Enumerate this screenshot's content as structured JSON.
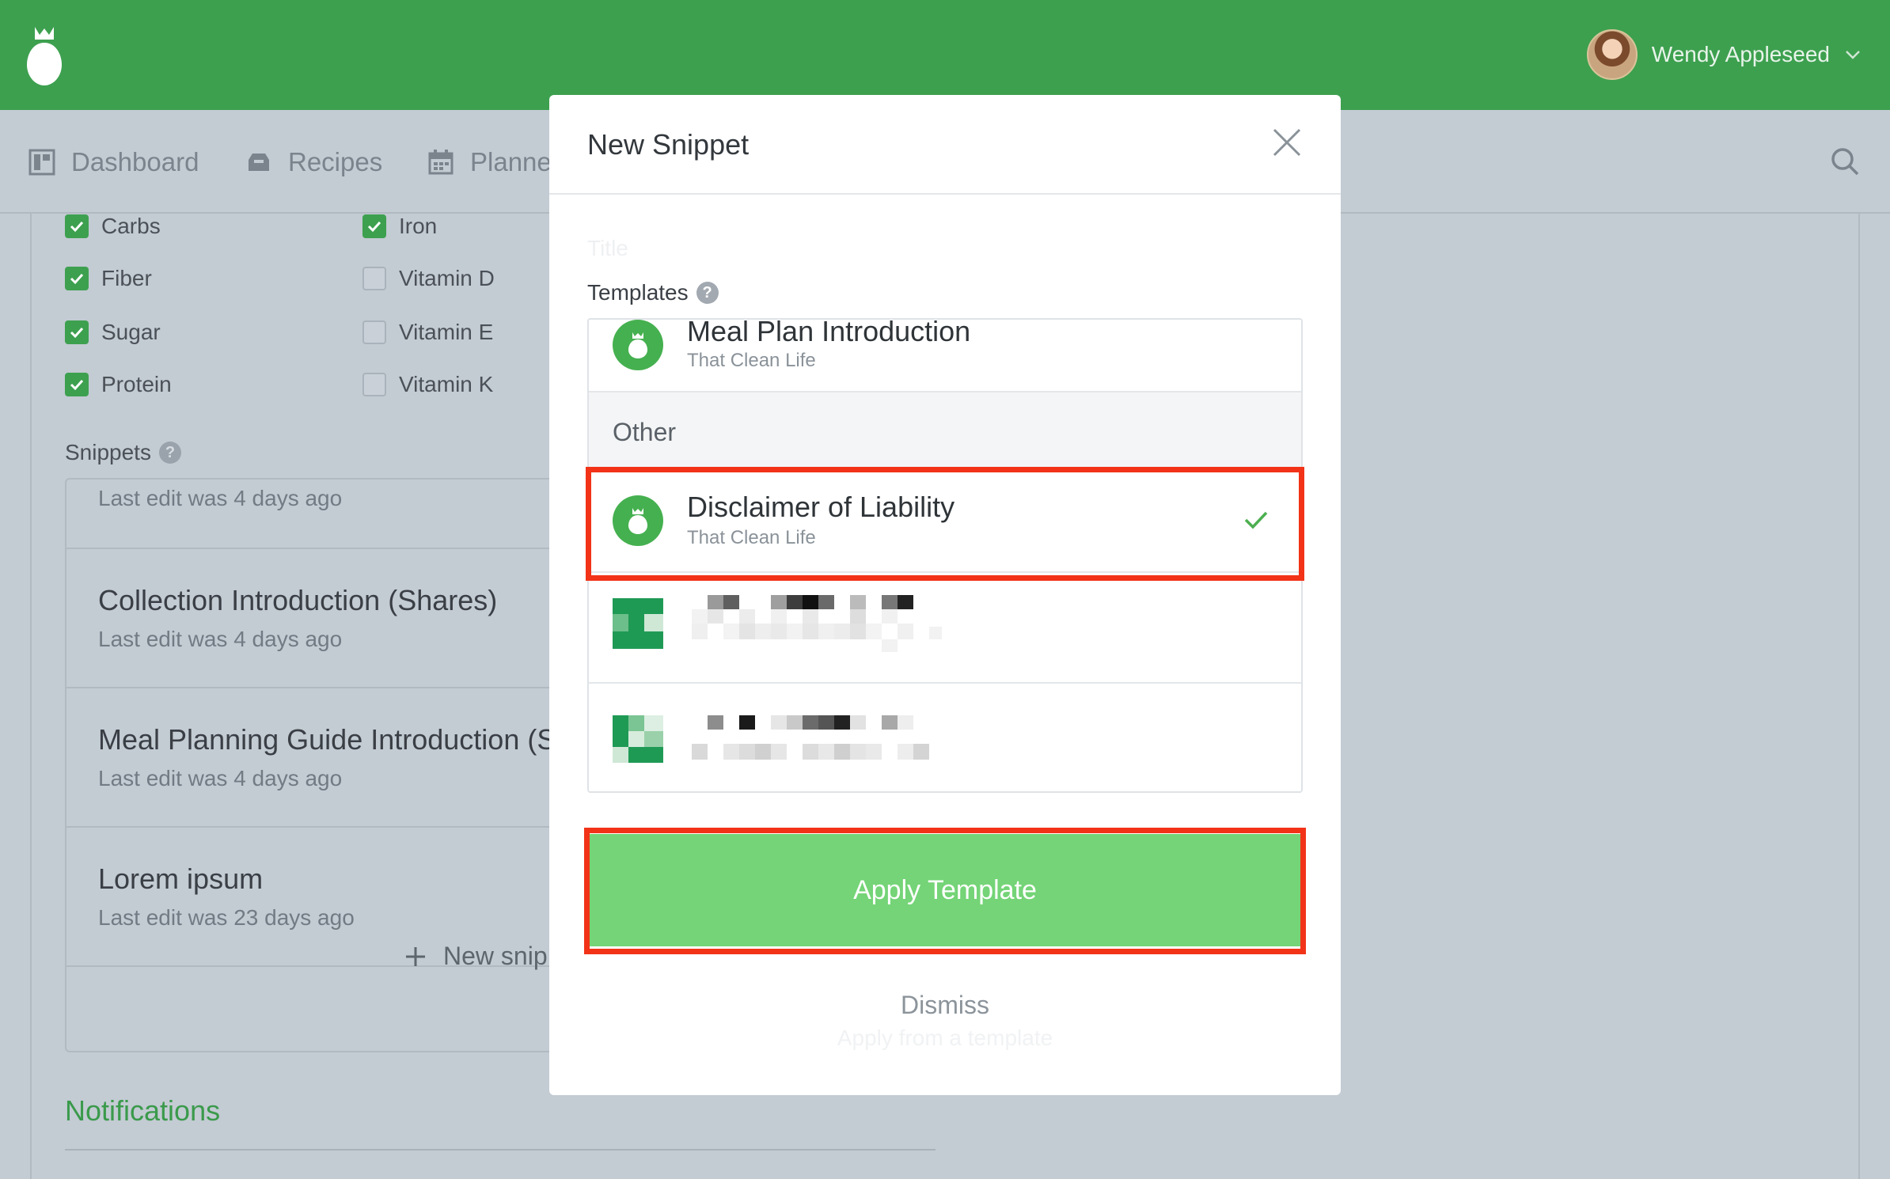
{
  "topbar": {
    "user_name": "Wendy Appleseed"
  },
  "nav": {
    "items": [
      {
        "label": "Dashboard",
        "icon": "dashboard-icon"
      },
      {
        "label": "Recipes",
        "icon": "inbox-icon"
      },
      {
        "label": "Planne",
        "icon": "calendar-icon"
      }
    ],
    "search_icon": "search-icon"
  },
  "nutrients": {
    "left": [
      {
        "label": "Carbs",
        "checked": true
      },
      {
        "label": "Fiber",
        "checked": true
      },
      {
        "label": "Sugar",
        "checked": true
      },
      {
        "label": "Protein",
        "checked": true
      }
    ],
    "right": [
      {
        "label": "Iron",
        "checked": true
      },
      {
        "label": "Vitamin D",
        "checked": false
      },
      {
        "label": "Vitamin E",
        "checked": false
      },
      {
        "label": "Vitamin K",
        "checked": false
      }
    ]
  },
  "snippets": {
    "label": "Snippets",
    "help": "?",
    "items": [
      {
        "title": "",
        "subtitle": "Last edit was 4 days ago"
      },
      {
        "title": "Collection Introduction (Shares)",
        "subtitle": "Last edit was 4 days ago"
      },
      {
        "title": "Meal Planning Guide Introduction (S",
        "subtitle": "Last edit was 4 days ago"
      },
      {
        "title": "Lorem ipsum",
        "subtitle": "Last edit was 23 days ago"
      }
    ],
    "new_label": "New snip"
  },
  "notifications": {
    "label": "Notifications"
  },
  "modal": {
    "title": "New Snippet",
    "faded_field_label": "Title",
    "templates_label": "Templates",
    "help": "?",
    "templates": [
      {
        "name": "Meal Plan Introduction",
        "org": "That Clean Life"
      },
      {
        "name": "Disclaimer of Liability",
        "org": "That Clean Life",
        "selected": true
      }
    ],
    "group_label": "Other",
    "apply_label": "Apply Template",
    "dismiss_label": "Dismiss",
    "faded_footer": "Apply from a template"
  },
  "colors": {
    "brand_green": "#3da04f",
    "apply_green": "#74d477",
    "highlight_red": "#f23318"
  }
}
